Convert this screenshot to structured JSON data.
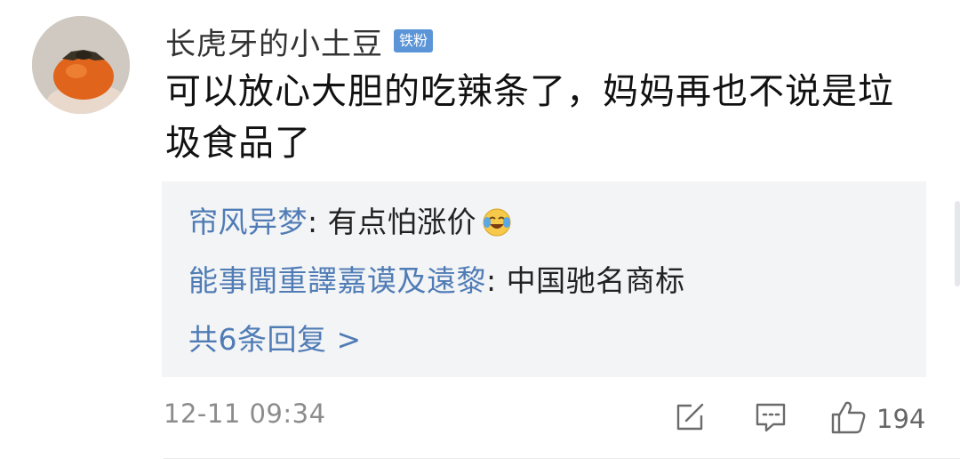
{
  "comment": {
    "username": "长虎牙的小土豆",
    "badge": "铁粉",
    "text": "可以放心大胆的吃辣条了，妈妈再也不说是垃圾食品了",
    "timestamp": "12-11 09:34",
    "like_count": "194",
    "avatar_icon": "persimmon-avatar"
  },
  "replies": [
    {
      "author": "帘风异梦",
      "separator": ": ",
      "text": "有点怕涨价",
      "emoji": "laugh-cry-emoji"
    },
    {
      "author": "能事聞重譯嘉谟及遠黎",
      "separator": ": ",
      "text": "中国驰名商标"
    }
  ],
  "more_replies": "共6条回复 >",
  "colors": {
    "link_blue": "#507cb5",
    "badge_blue": "#5b95d7",
    "reply_bg": "#f3f4f6",
    "meta_gray": "#8c8c8c"
  },
  "icons": {
    "share": "share-edit-icon",
    "comment": "comment-icon",
    "like": "thumbs-up-icon"
  }
}
